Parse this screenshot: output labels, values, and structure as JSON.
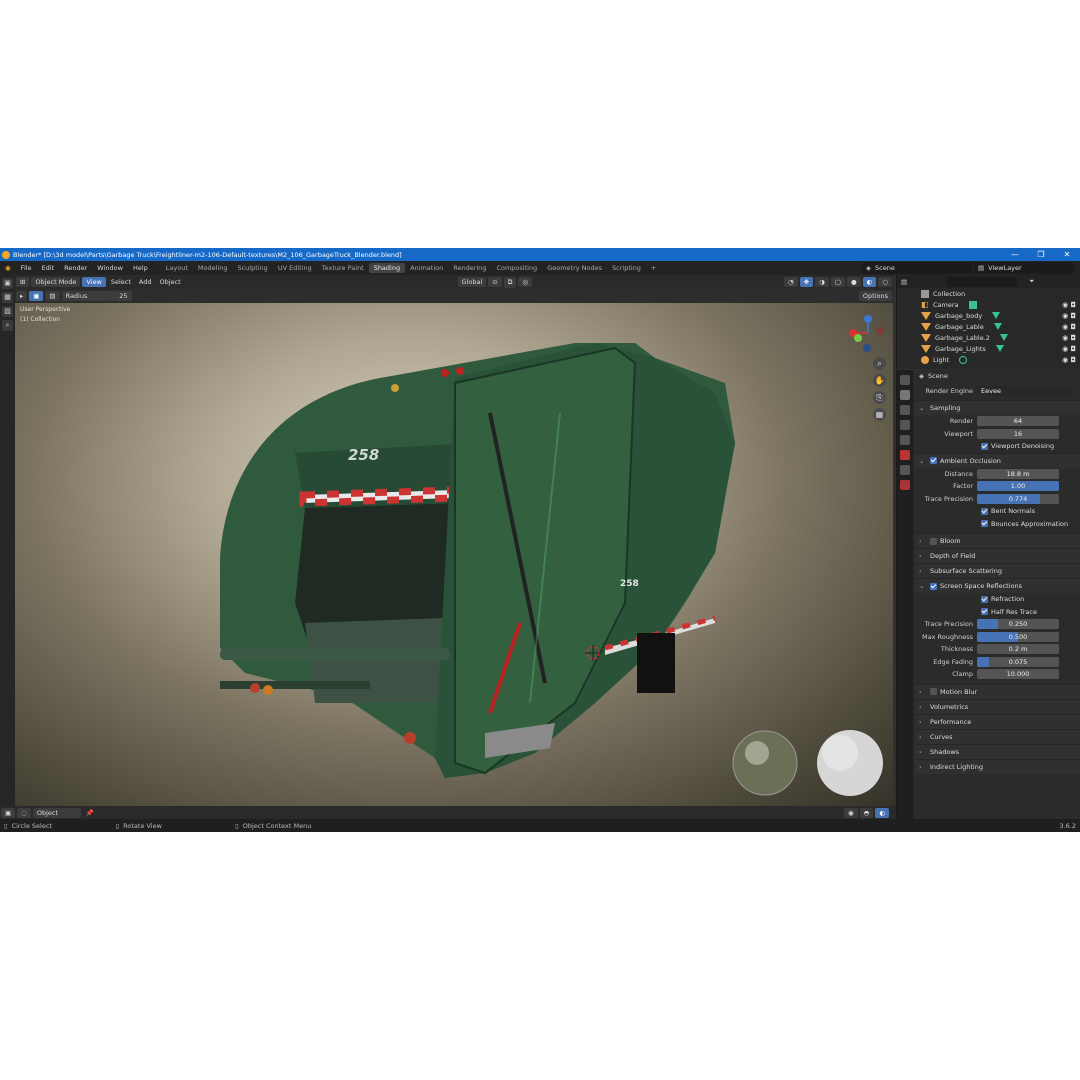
{
  "title_bar": {
    "title": "Blender* [D:\\3d model\\Parts\\Garbage Truck\\Freightliner-m2-106-Default-textures\\M2_106_GarbageTruck_Blender.blend]",
    "minimize": "—",
    "maximize": "❐",
    "close": "✕"
  },
  "menu": [
    "File",
    "Edit",
    "Render",
    "Window",
    "Help"
  ],
  "workspaces": [
    "Layout",
    "Modeling",
    "Sculpting",
    "UV Editing",
    "Texture Paint",
    "Shading",
    "Animation",
    "Rendering",
    "Compositing",
    "Geometry Nodes",
    "Scripting"
  ],
  "active_workspace": "Shading",
  "scene": {
    "label": "Scene",
    "view_layer": "ViewLayer"
  },
  "viewport_header": {
    "mode": "Object Mode",
    "view": "View",
    "select": "Select",
    "add": "Add",
    "object": "Object",
    "orientation": "Global",
    "options": "Options"
  },
  "tool_settings": {
    "radius_label": "Radius",
    "radius_value": "25"
  },
  "viewport": {
    "perspective": "User Perspective",
    "collection": "(1) Collection",
    "truck_number": "258"
  },
  "footer": {
    "object_label": "Object"
  },
  "status": {
    "left": "Circle Select",
    "middle": "Rotate View",
    "right": "Object Context Menu",
    "version": "3.6.2"
  },
  "outliner": {
    "root": "Collection",
    "items": [
      {
        "name": "Camera",
        "type": "camera"
      },
      {
        "name": "Garbage_body",
        "type": "mesh"
      },
      {
        "name": "Garbage_Lable",
        "type": "mesh"
      },
      {
        "name": "Garbage_Lable.2",
        "type": "mesh"
      },
      {
        "name": "Garbage_Lights",
        "type": "mesh"
      },
      {
        "name": "Light",
        "type": "light"
      }
    ]
  },
  "properties": {
    "context": "Scene",
    "render_engine_label": "Render Engine",
    "render_engine": "Eevee",
    "sampling": {
      "header": "Sampling",
      "render_label": "Render",
      "render": "64",
      "viewport_label": "Viewport",
      "viewport": "16",
      "denoise": "Viewport Denoising"
    },
    "ao": {
      "header": "Ambient Occlusion",
      "distance_label": "Distance",
      "distance": "18.8 m",
      "factor_label": "Factor",
      "factor": "1.00",
      "factor_fill": 1.0,
      "trace_label": "Trace Precision",
      "trace": "0.774",
      "trace_fill": 0.774,
      "bent": "Bent Normals",
      "bounces": "Bounces Approximation"
    },
    "bloom": "Bloom",
    "dof": "Depth of Field",
    "sss": "Subsurface Scattering",
    "ssr": {
      "header": "Screen Space Reflections",
      "refraction": "Refraction",
      "half_res": "Half Res Trace",
      "trace_label": "Trace Precision",
      "trace": "0.250",
      "trace_fill": 0.25,
      "rough_label": "Max Roughness",
      "rough": "0.500",
      "rough_fill": 0.5,
      "thick_label": "Thickness",
      "thick": "0.2 m",
      "edge_label": "Edge Fading",
      "edge": "0.075",
      "edge_fill": 0.15,
      "clamp_label": "Clamp",
      "clamp": "10.000"
    },
    "closed_panels": [
      "Motion Blur",
      "Volumetrics",
      "Performance",
      "Curves",
      "Shadows",
      "Indirect Lighting"
    ]
  },
  "colors": {
    "accent": "#4772b3",
    "title_blue": "#1769c7",
    "truck_green": "#2f5a3e"
  }
}
